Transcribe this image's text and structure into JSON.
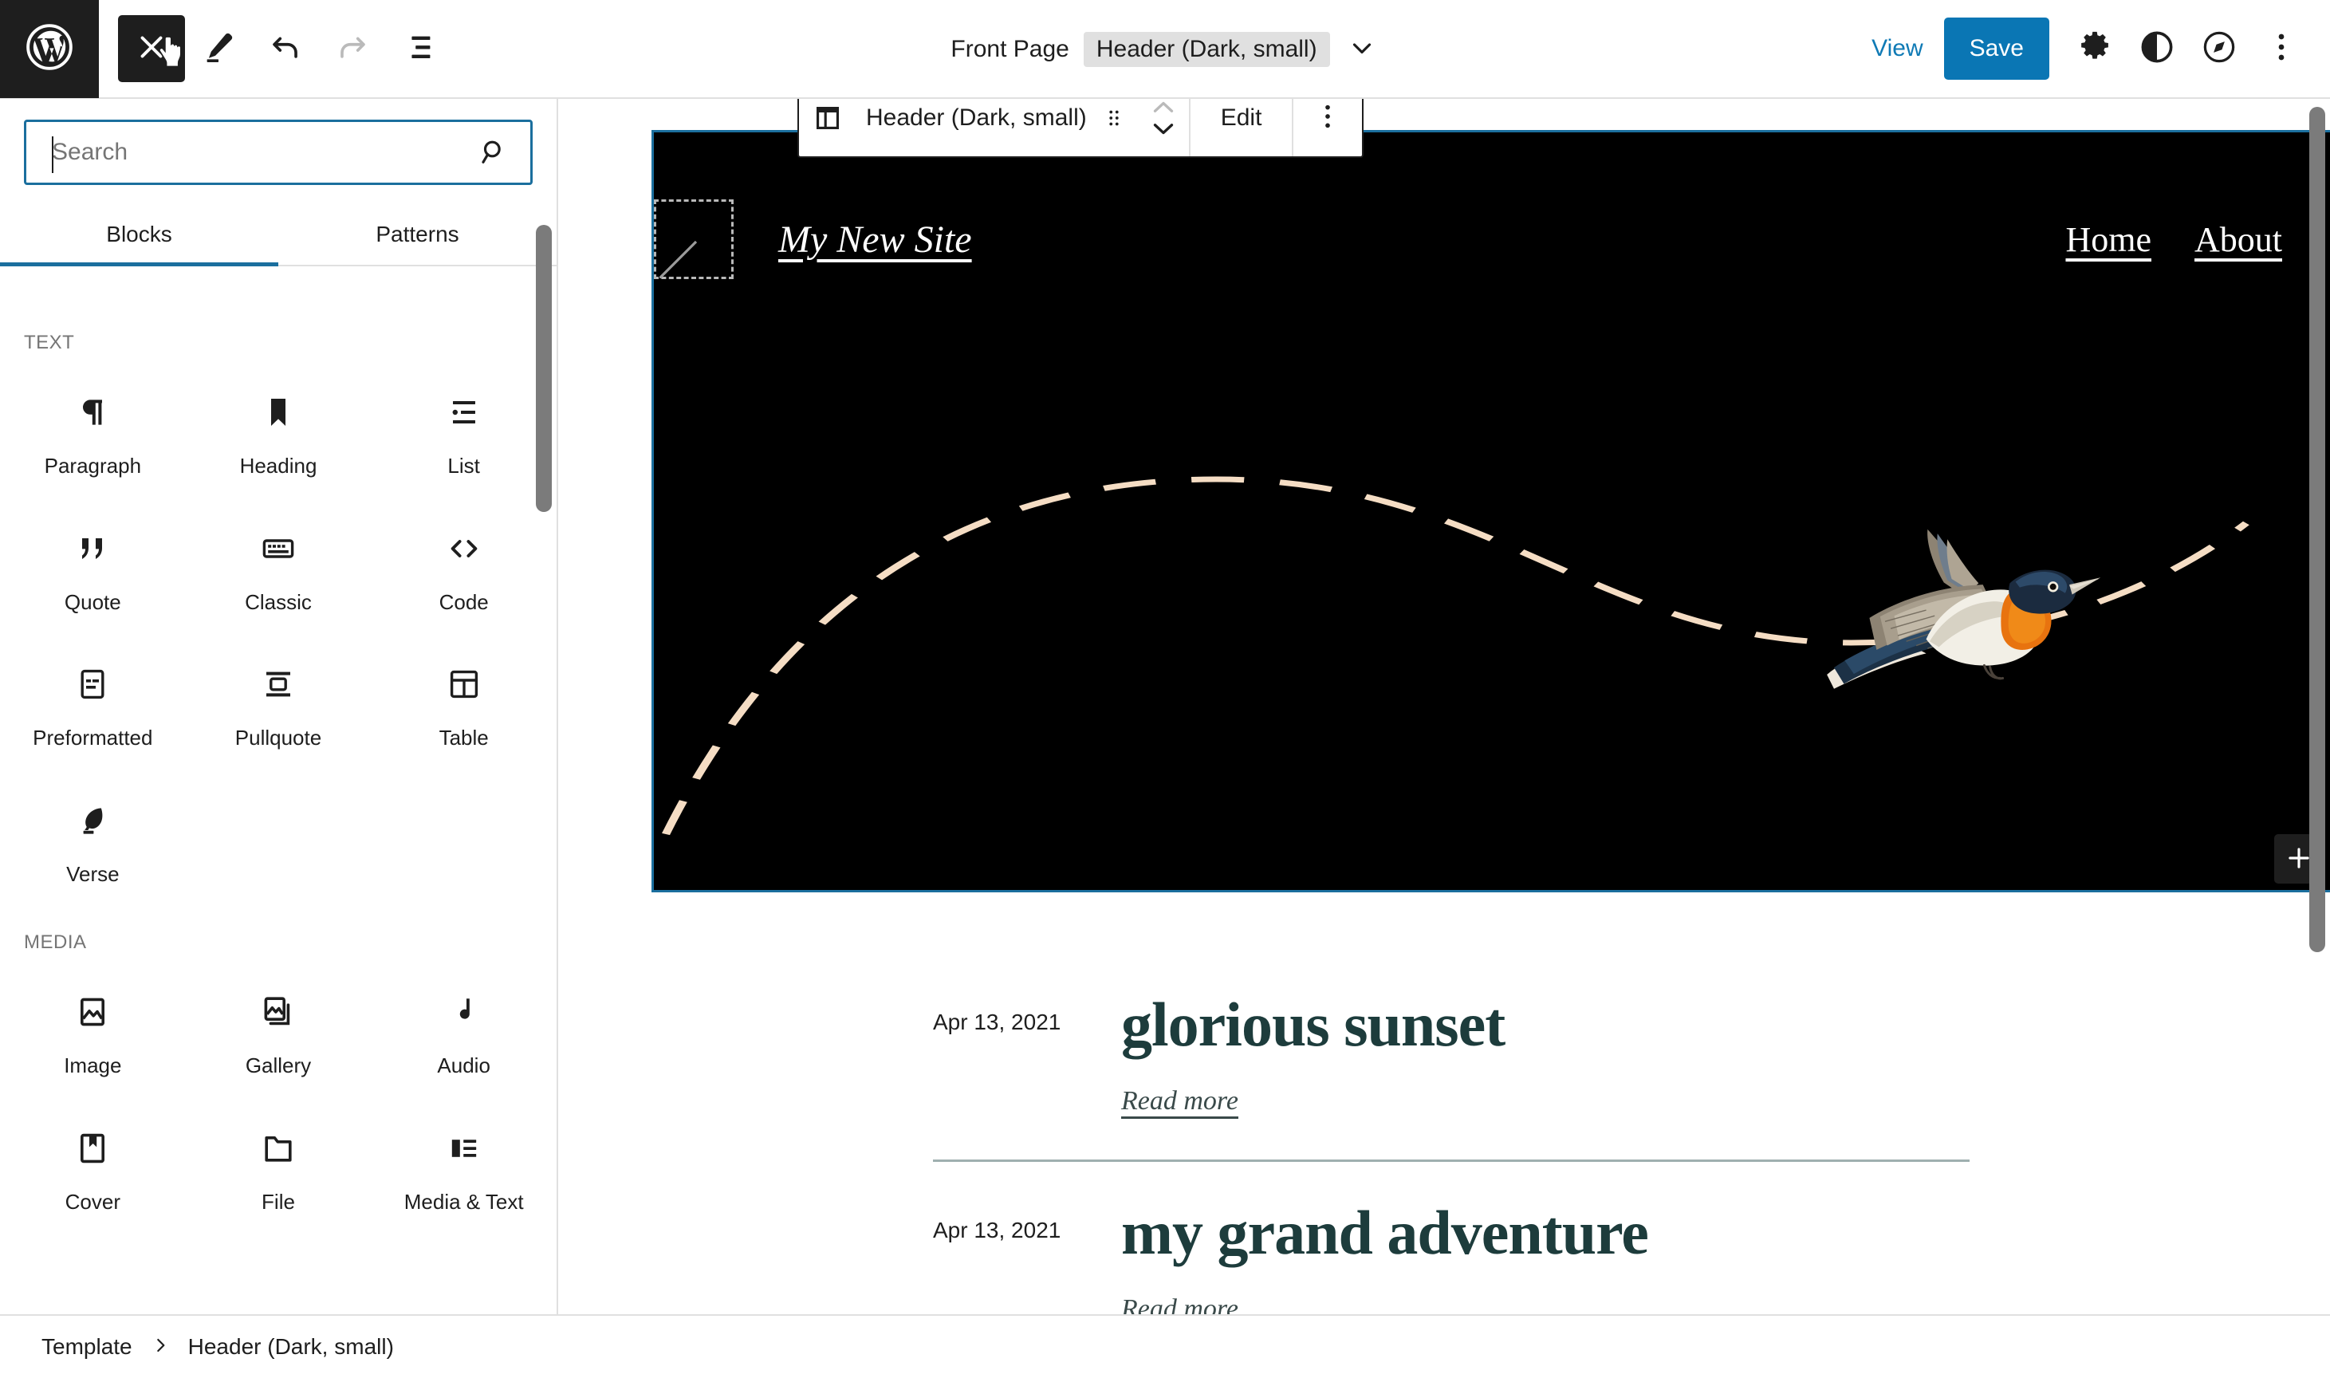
{
  "topbar": {
    "wp_logo": "wordpress-logo",
    "close_label": "Close",
    "edit_label": "Edit",
    "undo_label": "Undo",
    "redo_label": "Redo",
    "list_view_label": "List View",
    "document_type": "Front Page",
    "document_badge": "Header (Dark, small)",
    "view_label": "View",
    "save_label": "Save",
    "settings_label": "Settings",
    "styles_label": "Styles",
    "navigation_label": "Navigation",
    "options_label": "Options",
    "accent_color": "#0a76b4",
    "link_color": "#0f7ab5"
  },
  "inserter": {
    "search": {
      "value": "",
      "placeholder": "Search",
      "icon": "search-icon"
    },
    "tabs": [
      {
        "label": "Blocks",
        "active": true
      },
      {
        "label": "Patterns",
        "active": false
      }
    ],
    "sections": [
      {
        "title": "TEXT",
        "blocks": [
          {
            "label": "Paragraph",
            "icon": "pilcrow-icon"
          },
          {
            "label": "Heading",
            "icon": "bookmark-icon"
          },
          {
            "label": "List",
            "icon": "list-icon"
          },
          {
            "label": "Quote",
            "icon": "quote-icon"
          },
          {
            "label": "Classic",
            "icon": "keyboard-icon"
          },
          {
            "label": "Code",
            "icon": "code-icon"
          },
          {
            "label": "Preformatted",
            "icon": "preformatted-icon"
          },
          {
            "label": "Pullquote",
            "icon": "pullquote-icon"
          },
          {
            "label": "Table",
            "icon": "table-icon"
          },
          {
            "label": "Verse",
            "icon": "quill-icon"
          }
        ]
      },
      {
        "title": "MEDIA",
        "blocks": [
          {
            "label": "Image",
            "icon": "image-icon"
          },
          {
            "label": "Gallery",
            "icon": "gallery-icon"
          },
          {
            "label": "Audio",
            "icon": "audio-note-icon"
          },
          {
            "label": "Cover",
            "icon": "cover-icon"
          },
          {
            "label": "File",
            "icon": "folder-icon"
          },
          {
            "label": "Media & Text",
            "icon": "media-text-icon"
          }
        ]
      }
    ]
  },
  "block_toolbar": {
    "block_icon": "template-part-icon",
    "block_name": "Header (Dark, small)",
    "drag_label": "Drag",
    "move_up_label": "Move up",
    "move_down_label": "Move down",
    "edit_label": "Edit",
    "options_label": "Options"
  },
  "canvas": {
    "selected_block_color": "#1b6f9e",
    "header": {
      "background": "#000000",
      "logo_placeholder": "site-logo-placeholder",
      "site_title": "My New Site",
      "nav_items": [
        "Home",
        "About"
      ],
      "decoration": "dashed-swoosh-curve",
      "decoration_color": "#f5ddc4",
      "illustration": "flying-bird-illustration",
      "add_block_label": "Add block"
    },
    "posts": [
      {
        "date": "Apr 13, 2021",
        "title": "glorious sunset",
        "read_more": "Read more"
      },
      {
        "date": "Apr 13, 2021",
        "title": "my grand adventure",
        "read_more": "Read more"
      }
    ],
    "post_title_color": "#1d3c3c"
  },
  "footer": {
    "breadcrumb": [
      {
        "label": "Template"
      },
      {
        "label": "Header (Dark, small)"
      }
    ],
    "separator_icon": "chevron-right-icon"
  }
}
